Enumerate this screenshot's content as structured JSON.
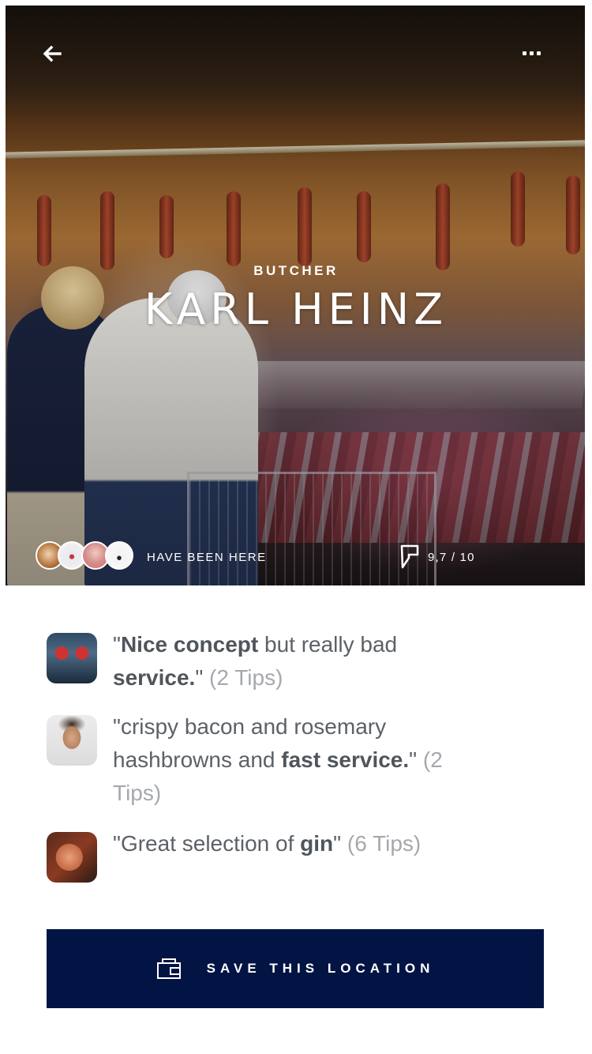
{
  "venue": {
    "category": "BUTCHER",
    "name": "KARL HEINZ",
    "visitors_label": "HAVE BEEN HERE",
    "rating": "9,7 / 10"
  },
  "navigation": {
    "back_icon": "arrow-left",
    "more_icon": "ellipsis-horizontal"
  },
  "tips": [
    {
      "avatar": "user-avatar-1",
      "parts": [
        {
          "text": "\"",
          "style": "normal"
        },
        {
          "text": "Nice concept",
          "style": "bold"
        },
        {
          "text": " but really bad ",
          "style": "normal"
        },
        {
          "text": "service.",
          "style": "bold"
        },
        {
          "text": "\" ",
          "style": "normal"
        },
        {
          "text": "(2 Tips)",
          "style": "count"
        }
      ]
    },
    {
      "avatar": "user-avatar-2",
      "parts": [
        {
          "text": "\"crispy bacon and rosemary hashbrowns and ",
          "style": "normal"
        },
        {
          "text": "fast",
          "style": "bold"
        },
        {
          "text": " ",
          "style": "normal"
        },
        {
          "text": "service.",
          "style": "bold"
        },
        {
          "text": "\" ",
          "style": "normal"
        },
        {
          "text": "(2 Tips)",
          "style": "count"
        }
      ]
    },
    {
      "avatar": "user-avatar-3",
      "parts": [
        {
          "text": "\"Great selection of ",
          "style": "normal"
        },
        {
          "text": "gin",
          "style": "bold"
        },
        {
          "text": "\" ",
          "style": "normal"
        },
        {
          "text": "(6 Tips)",
          "style": "count"
        }
      ]
    }
  ],
  "save_button": {
    "label": "SAVE THIS LOCATION",
    "icon": "wallet-icon"
  },
  "colors": {
    "button_bg": "#011444",
    "tip_text": "#5c6168",
    "tip_count": "#a5a8ad"
  }
}
